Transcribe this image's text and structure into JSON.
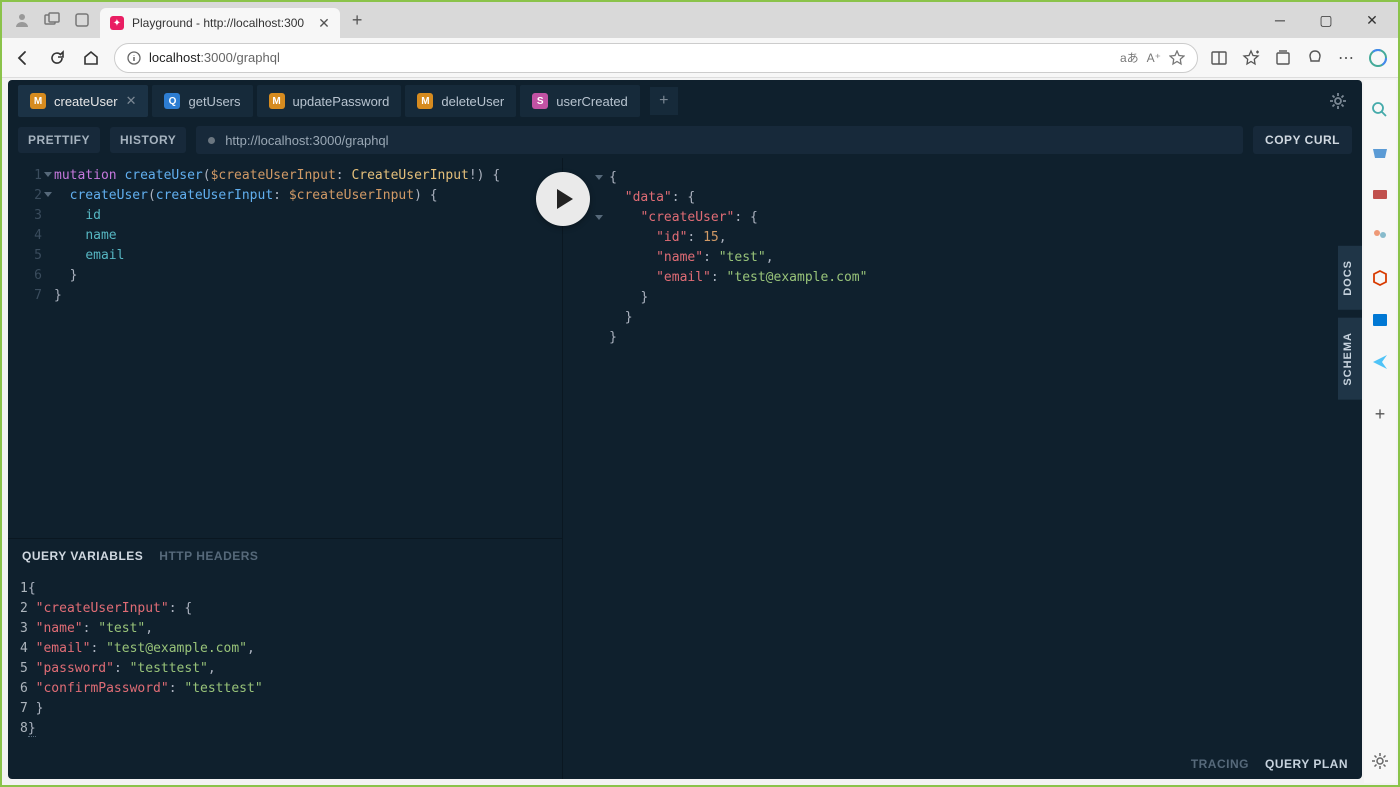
{
  "browser": {
    "tab_title": "Playground - http://localhost:300",
    "url_host": "localhost",
    "url_port": ":3000",
    "url_path": "/graphql"
  },
  "tabs": [
    {
      "badge": "M",
      "label": "createUser",
      "active": true
    },
    {
      "badge": "Q",
      "label": "getUsers",
      "active": false
    },
    {
      "badge": "M",
      "label": "updatePassword",
      "active": false
    },
    {
      "badge": "M",
      "label": "deleteUser",
      "active": false
    },
    {
      "badge": "S",
      "label": "userCreated",
      "active": false
    }
  ],
  "toolbar": {
    "prettify": "PRETTIFY",
    "history": "HISTORY",
    "endpoint": "http://localhost:3000/graphql",
    "copy_curl": "COPY CURL"
  },
  "query": {
    "lines": [
      "mutation createUser($createUserInput: CreateUserInput!) {",
      "  createUser(createUserInput: $createUserInput) {",
      "    id",
      "    name",
      "    email",
      "  }",
      "}"
    ]
  },
  "var_tabs": {
    "variables": "QUERY VARIABLES",
    "headers": "HTTP HEADERS"
  },
  "variables": {
    "createUserInput": {
      "name": "test",
      "email": "test@example.com",
      "password": "testtest",
      "confirmPassword": "testtest"
    }
  },
  "response": {
    "data": {
      "createUser": {
        "id": 15,
        "name": "test",
        "email": "test@example.com"
      }
    }
  },
  "side_tabs": {
    "docs": "DOCS",
    "schema": "SCHEMA"
  },
  "footer": {
    "tracing": "TRACING",
    "query_plan": "QUERY PLAN"
  }
}
